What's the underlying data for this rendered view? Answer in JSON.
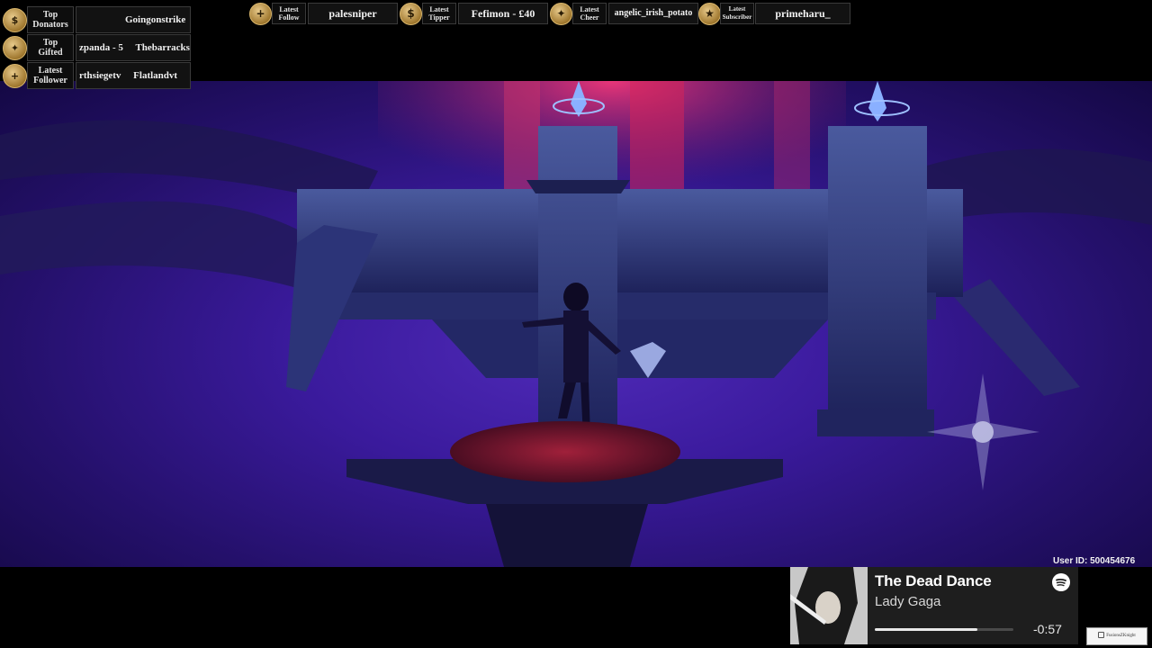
{
  "left_panel": {
    "rows": [
      {
        "icon": "dollar-icon",
        "label_line1": "Top",
        "label_line2": "Donators",
        "value": "Goingonstrike"
      },
      {
        "icon": "gift-icon",
        "label_line1": "Top",
        "label_line2": "Gifted",
        "value": "zpanda - 5     Thebarracks"
      },
      {
        "icon": "plus-icon",
        "label_line1": "Latest",
        "label_line2": "Follower",
        "value": "rthsiegetv     Flatlandvt"
      }
    ]
  },
  "top_bar": {
    "items": [
      {
        "icon": "plus-icon",
        "label_line1": "Latest",
        "label_line2": "Follow",
        "value": "palesniper"
      },
      {
        "icon": "dollar-icon",
        "label_line1": "Latest",
        "label_line2": "Tipper",
        "value": "Fefimon - £40"
      },
      {
        "icon": "cheer-icon",
        "label_line1": "Latest",
        "label_line2": "Cheer",
        "value": "angelic_irish_potato"
      },
      {
        "icon": "subscriber-icon",
        "label_line1": "Latest",
        "label_line2": "Subscriber",
        "value": "primeharu_"
      }
    ]
  },
  "now_playing": {
    "title": "The Dead Dance",
    "artist": "Lady Gaga",
    "time_remaining": "-0:57",
    "progress": 0.74,
    "service_icon": "spotify-icon"
  },
  "user_id": "User ID: 500454676",
  "watermark": "FusionsZKnight",
  "colors": {
    "gold": "#c9a55a",
    "scene_purple": "#3a1a9c",
    "spotlight_red": "#d4245a"
  }
}
